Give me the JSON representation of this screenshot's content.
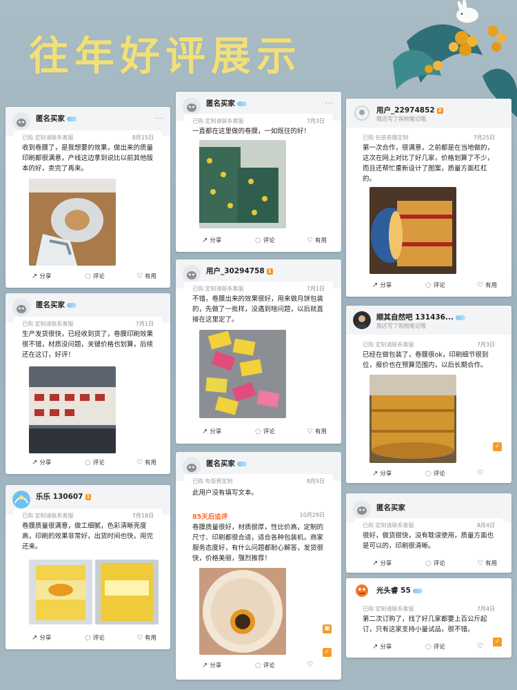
{
  "page": {
    "title": "往年好评展示"
  },
  "common": {
    "share": "分享",
    "comment": "评论",
    "useful": "有用",
    "more": "···"
  },
  "cards": [
    {
      "user": "匿名买家",
      "sub": "",
      "level": "",
      "meta": "已购 定制请联系客服",
      "date": "8月15日",
      "text": "收到卷膜了，是我想要的效果，做出来的质量印刷都很满意，产线这边拿到说比以前其他版本的好，卖完了再来。"
    },
    {
      "user": "匿名买家",
      "sub": "",
      "level": "",
      "meta": "已购 定制请联系客服",
      "date": "7月3日",
      "text": "一直都在这里做的卷膜，一如既往的好！"
    },
    {
      "user": "用户_22974852",
      "sub": "我还写了购物笔记哦",
      "level": "2",
      "meta": "已购 包装卷膜定制",
      "date": "7月25日",
      "text": "第一次合作，很满意，之前都是在当地做的，这次在网上对比了好几家，价格划算了不少，而且还帮忙重新设计了图案，质量方面杠杠的。"
    },
    {
      "user": "匿名买家",
      "sub": "",
      "level": "",
      "meta": "已购 定制请联系客服",
      "date": "7月1日",
      "text": "生产发货很快，已经收到货了，卷膜印刷效果很不错，材质没问题，关键价格也划算，后续还在这订，好评！"
    },
    {
      "user": "用户_30294758",
      "sub": "",
      "level": "1",
      "meta": "已购 定制请联系客服",
      "date": "7月1日",
      "text": "不错，卷膜出来的效果很好，用来做月饼包装的，先做了一批样，没遇到啥问题，以后就直接在这里定了。"
    },
    {
      "user": "顺其自然吧 131436...",
      "sub": "我还写了购物笔记哦",
      "level": "",
      "meta": "已购 定制请联系客服",
      "date": "7月3日",
      "text": "已经在做包装了，卷膜很ok，印刷细节很到位，报价也在预算范围内，以后长期合作。"
    },
    {
      "user": "乐乐 130607",
      "sub": "",
      "level": "1",
      "meta": "已购 定制请联系客服",
      "date": "7月18日",
      "text": "卷膜质量很满意，做工细腻，色彩清晰亮度高，印刷的效果非常好，出货时间也快，用完还来。"
    },
    {
      "user": "匿名买家",
      "sub": "",
      "level": "",
      "meta": "已购 免版费定制",
      "date": "8月5日",
      "text": "此用户没有填写文本。",
      "followup_label": "85天后追评",
      "followup_date": "10月29日",
      "followup_text": "卷膜质量很好，材质很厚，性比价高，定制的尺寸、印刷都很合适，适合各种包装机，商家服务态度好，有什么问题都耐心解答，发货很快，价格美丽，强烈推荐！"
    },
    {
      "user": "匿名买家",
      "sub": "",
      "level": "",
      "meta": "已购 定制请联系客服",
      "date": "8月4日",
      "text": "很好，做货很快，没有耽误使用，质量方面也是可以的，印刷很清晰。"
    },
    {
      "user": "光头睿 55",
      "sub": "",
      "level": "",
      "meta": "已购 定制请联系客服",
      "date": "7月4日",
      "text": "第二次订购了，找了好几家都要上百公斤起订，只有这家支持小量试品，很不错。"
    }
  ],
  "colors": {
    "title": "#f1e07a",
    "followup": "#ff6a2c",
    "accent": "#f59b23"
  }
}
